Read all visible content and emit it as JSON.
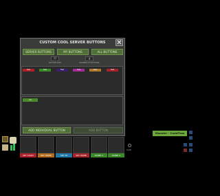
{
  "dialog": {
    "title": "CUSTOM COOL SERVER BUTTONS",
    "close_label": "✕",
    "tabs": [
      "SERVER BUTTONS",
      "MY BUTTONS",
      "ALL BUTTONS"
    ],
    "button_size_value": "??",
    "button_size_label": "BUTTON SIZE",
    "number_of_buttons_value": "4",
    "number_of_buttons_label": "NUMBER OF BUTTONS",
    "test_buttons": [
      {
        "label": "Test",
        "color": "#b0202a"
      },
      {
        "label": "Test",
        "color": "#3b8a2a"
      },
      {
        "label": "Test",
        "color": "#3a1f6b"
      },
      {
        "label": "Test",
        "color": "#a62c9a"
      },
      {
        "label": "Test",
        "color": "#b07a2a"
      },
      {
        "label": "Test",
        "color": "#a4242a"
      }
    ],
    "selected_chip": "All",
    "add_button_label": "ADD INDIVIDUAL BUTTON",
    "add_button_disabled_label": "ADD BUTTON"
  },
  "hotbar": {
    "labels": [
      {
        "text": "SET START",
        "color": "#b0202a"
      },
      {
        "text": "SET HOME",
        "color": "#b56a1c"
      },
      {
        "text": "SET TP",
        "color": "#1f78a8"
      },
      {
        "text": "SET HOME",
        "color": "#a4242a"
      },
      {
        "text": "HOME 1",
        "color": "#3b8a2a"
      },
      {
        "text": "HOME 2",
        "color": "#3b8a2a"
      }
    ]
  },
  "status": {
    "count_text": "0/28",
    "monster_label": "Monster - CodeFlow"
  }
}
